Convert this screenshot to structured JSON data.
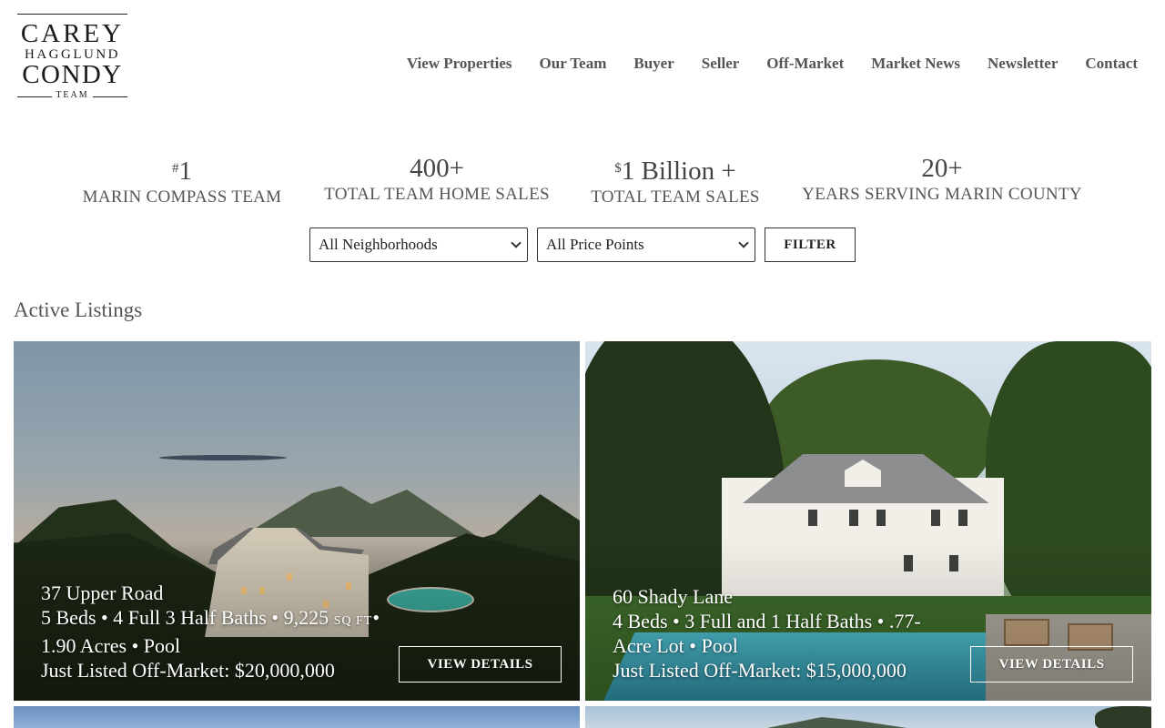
{
  "logo": {
    "line1": "CAREY",
    "line2": "HAGGLUND",
    "line3": "CONDY",
    "line4": "TEAM"
  },
  "nav": {
    "items": [
      {
        "label": "View Properties"
      },
      {
        "label": "Our Team"
      },
      {
        "label": "Buyer"
      },
      {
        "label": "Seller"
      },
      {
        "label": "Off-Market"
      },
      {
        "label": "Market News"
      },
      {
        "label": "Newsletter"
      },
      {
        "label": "Contact"
      }
    ]
  },
  "stats": [
    {
      "prefix": "#",
      "value": "1",
      "label": "MARIN COMPASS TEAM"
    },
    {
      "prefix": "",
      "value": "400+",
      "label": "TOTAL TEAM HOME SALES"
    },
    {
      "prefix": "$",
      "value": "1 Billion +",
      "label": "TOTAL TEAM SALES"
    },
    {
      "prefix": "",
      "value": "20+",
      "label": "YEARS SERVING MARIN COUNTY"
    }
  ],
  "filters": {
    "neighborhood_selected": "All Neighborhoods",
    "price_selected": "All Price Points",
    "filter_label": "FILTER"
  },
  "section_title": "Active Listings",
  "listings": [
    {
      "address": "37 Upper Road",
      "details_a": "5 Beds • 4 Full 3 Half Baths • 9,225 ",
      "sqft_unit": "SQ FT",
      "details_a_end": "•",
      "details_b": "1.90 Acres • Pool",
      "status_price": "Just Listed Off-Market: $20,000,000",
      "button_label": "VIEW DETAILS"
    },
    {
      "address": "60 Shady Lane",
      "details_a": "4 Beds • 3 Full and 1 Half Baths • .77-",
      "details_b": "Acre Lot • Pool",
      "status_price": "Just Listed Off-Market: $15,000,000",
      "button_label": "VIEW DETAILS"
    }
  ]
}
